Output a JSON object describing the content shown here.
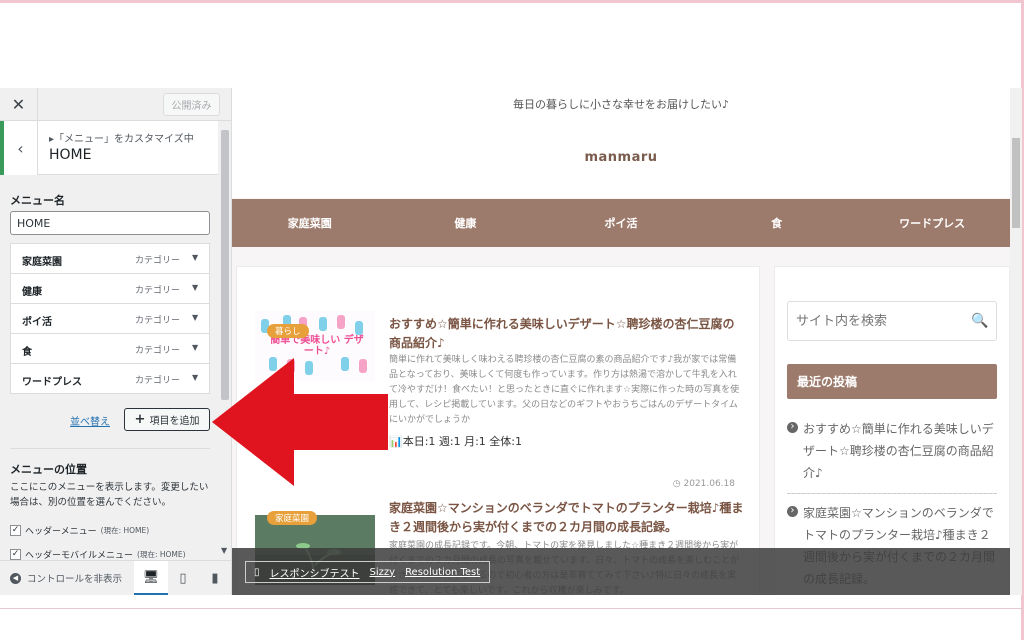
{
  "panel": {
    "close": "✕",
    "publish": "公開済み",
    "crumb": "▸「メニュー」をカスタマイズ中",
    "title": "HOME",
    "name_label": "メニュー名",
    "name_value": "HOME",
    "items": [
      {
        "label": "家庭菜園",
        "kind": "カテゴリー"
      },
      {
        "label": "健康",
        "kind": "カテゴリー"
      },
      {
        "label": "ポイ活",
        "kind": "カテゴリー"
      },
      {
        "label": "食",
        "kind": "カテゴリー"
      },
      {
        "label": "ワードプレス",
        "kind": "カテゴリー"
      }
    ],
    "reorder": "並べ替え",
    "add_item": "項目を追加",
    "location_title": "メニューの位置",
    "location_desc": "ここにこのメニューを表示します。変更したい場合は、別の位置を選んでください。",
    "locations": [
      {
        "label": "ヘッダーメニュー",
        "current": "(現在: HOME)",
        "checked": true
      },
      {
        "label": "ヘッダーモバイルメニュー",
        "current": "(現在: HOME)",
        "checked": true
      }
    ],
    "hide_controls": "コントロールを非表示"
  },
  "site": {
    "tagline": "毎日の暮らしに小さな幸せをお届けしたい♪",
    "logo": "manmaru",
    "nav": [
      "家庭菜園",
      "健康",
      "ポイ活",
      "食",
      "ワードプレス"
    ],
    "posts": [
      {
        "category": "暮らし",
        "thumb_text": "簡単で美味しい デザート♪",
        "title": "おすすめ☆簡単に作れる美味しいデザート☆聘珍楼の杏仁豆腐の商品紹介♪",
        "excerpt": "簡単に作れて美味しく味わえる聘珍楼の杏仁豆腐の素の商品紹介です♪我が家では常備品となっており、美味しくて何度も作っています。作り方は熱湯で溶かして牛乳を入れて冷やすだけ！食べたい！と思ったときに直ぐに作れます☆実際に作った時の写真を使用して、レシピ掲載しています。父の日などのギフトやおうちごはんのデザートタイムにいかがでしょうか",
        "stats": "本日:1 週:1 月:1 全体:1"
      },
      {
        "date": "2021.06.18",
        "category": "家庭菜園",
        "title": "家庭菜園☆マンションのベランダでトマトのプランター栽培♪種まき２週間後から実が付くまでの２カ月間の成長記録。",
        "excerpt": "家庭菜園の成長記録です。今朝、トマトの実を発見しました☆種まき２週間後から実が付くまでの２カ月間の成長の写真を載せています。日々、トマトの成長を楽しむことができ、簡単に育てられるので初心者の方は是非育ててみて下さい♪特に日々の成長を実感できて、とても楽しいです。これから収穫が楽しみです。"
      }
    ],
    "search_placeholder": "サイト内を検索",
    "recent_title": "最近の投稿",
    "recent": [
      "おすすめ☆簡単に作れる美味しいデザート☆聘珍楼の杏仁豆腐の商品紹介♪",
      "家庭菜園☆マンションのベランダでトマトのプランター栽培♪種まき２週間後から実が付くまでの２カ月間の成長記録。"
    ]
  },
  "testbar": {
    "responsive": "レスポンシブテスト",
    "sizzy": "Sizzy",
    "resolution": "Resolution Test"
  },
  "colors": {
    "nav": "#9d7b6c",
    "arrow": "#e0141e",
    "accent": "#2271b1",
    "badge": "#e7a03a"
  }
}
